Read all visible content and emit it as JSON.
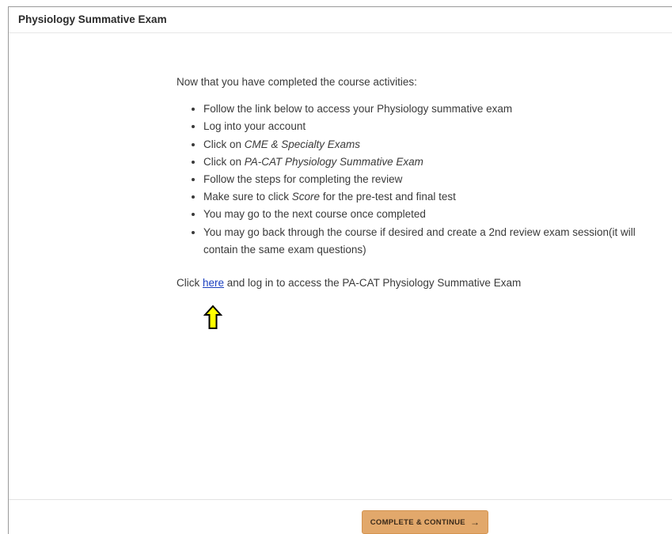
{
  "header": {
    "title": "Physiology Summative Exam"
  },
  "main": {
    "intro": "Now that you have completed the course activities:",
    "list": [
      {
        "before": "Follow the link below to access your Physiology summative exam",
        "em": "",
        "after": ""
      },
      {
        "before": "Log into your account",
        "em": "",
        "after": ""
      },
      {
        "before": "Click on ",
        "em": "CME & Specialty Exams",
        "after": ""
      },
      {
        "before": "Click on ",
        "em": "PA-CAT Physiology Summative Exam",
        "after": ""
      },
      {
        "before": "Follow the steps for completing the review",
        "em": "",
        "after": ""
      },
      {
        "before": "Make sure to click ",
        "em": "Score",
        "after": " for the pre-test and final test"
      },
      {
        "before": "You may go to the next course once completed",
        "em": "",
        "after": ""
      },
      {
        "before": "You may go back through the course if desired and create a 2nd review exam session(it will contain the same exam questions)",
        "em": "",
        "after": ""
      }
    ],
    "cta": {
      "prefix": "Click ",
      "link_text": "here",
      "suffix": " and log in to access the PA-CAT Physiology Summative Exam"
    },
    "pointer_icon": "up-arrow-icon",
    "pointer_color": "#ffff00"
  },
  "footer": {
    "button_label": "COMPLETE & CONTINUE",
    "button_icon": "→",
    "button_color": "#e2a86b"
  }
}
